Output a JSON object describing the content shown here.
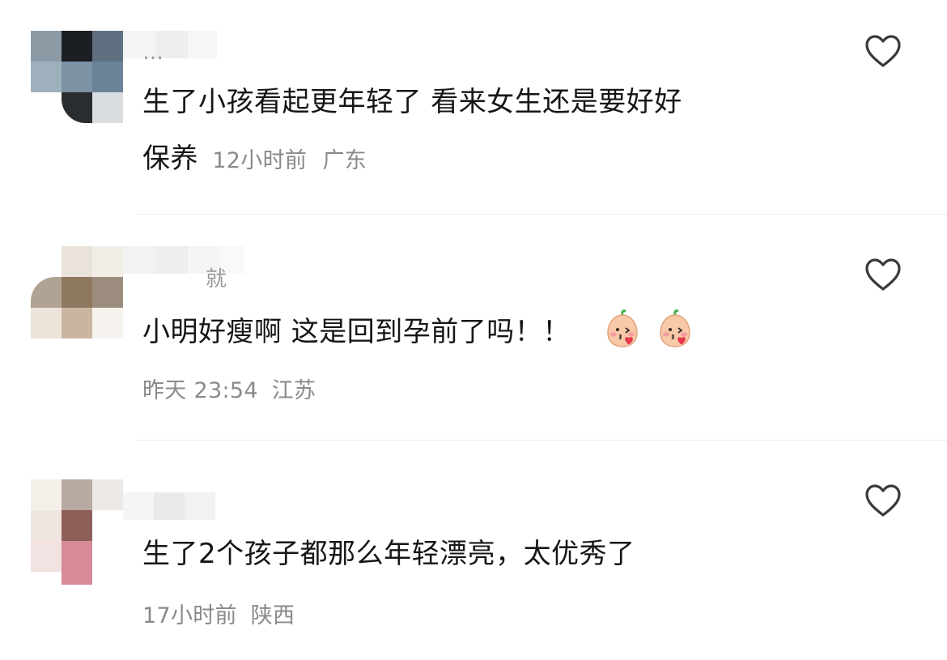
{
  "comments": [
    {
      "username_visible": "…",
      "text_line1": "生了小孩看起更年轻了 看来女生还是要好好",
      "text_line2": "保养",
      "time": "12小时前",
      "location": "广东",
      "liked": false
    },
    {
      "username_visible": "就",
      "text": "小明好瘦啊 这是回到孕前了吗！！",
      "emojis": [
        "peach-kiss-emoji",
        "peach-kiss-emoji"
      ],
      "time": "昨天 23:54",
      "location": "江苏",
      "liked": false
    },
    {
      "username_visible": "",
      "text": "生了2个孩子都那么年轻漂亮，太优秀了",
      "time": "17小时前",
      "location": "陕西",
      "liked": false
    }
  ],
  "icons": {
    "like": "heart-outline-icon"
  },
  "colors": {
    "text": "#161616",
    "meta": "#8a8a8a",
    "divider": "#ebebeb",
    "heart": "#3a3a3a"
  }
}
